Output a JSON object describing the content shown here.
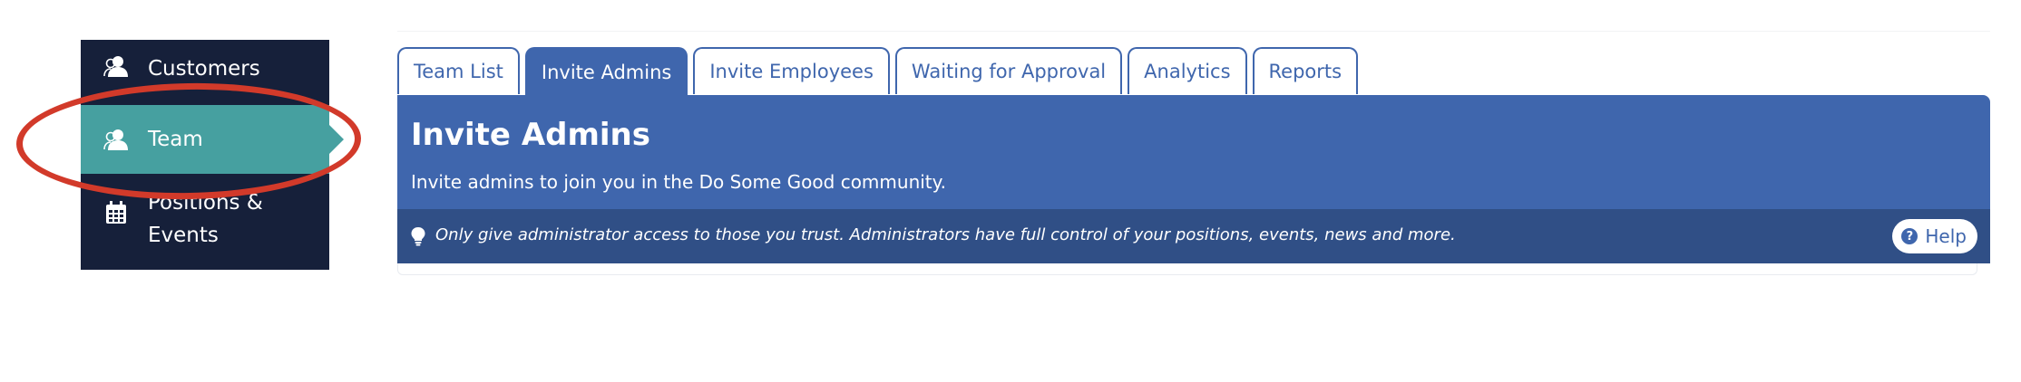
{
  "sidebar": {
    "items": [
      {
        "label": "Customers",
        "icon": "users-icon"
      },
      {
        "label": "Team",
        "icon": "users-icon",
        "active": true
      },
      {
        "label": "Positions & Events",
        "icon": "calendar-icon"
      }
    ]
  },
  "tabs": [
    {
      "label": "Team List"
    },
    {
      "label": "Invite Admins",
      "active": true
    },
    {
      "label": "Invite Employees"
    },
    {
      "label": "Waiting for Approval"
    },
    {
      "label": "Analytics"
    },
    {
      "label": "Reports"
    }
  ],
  "panel": {
    "title": "Invite Admins",
    "subtitle": "Invite admins to join you in the Do Some Good community.",
    "note": "Only give administrator access to those you trust. Administrators have full control of your positions, events, news and more.",
    "help_label": "Help"
  },
  "colors": {
    "sidebar_bg": "#16203a",
    "active_item": "#46a0a0",
    "brand_blue": "#3f66ad",
    "note_bg": "#304f86",
    "annotation": "#d23a2a"
  }
}
